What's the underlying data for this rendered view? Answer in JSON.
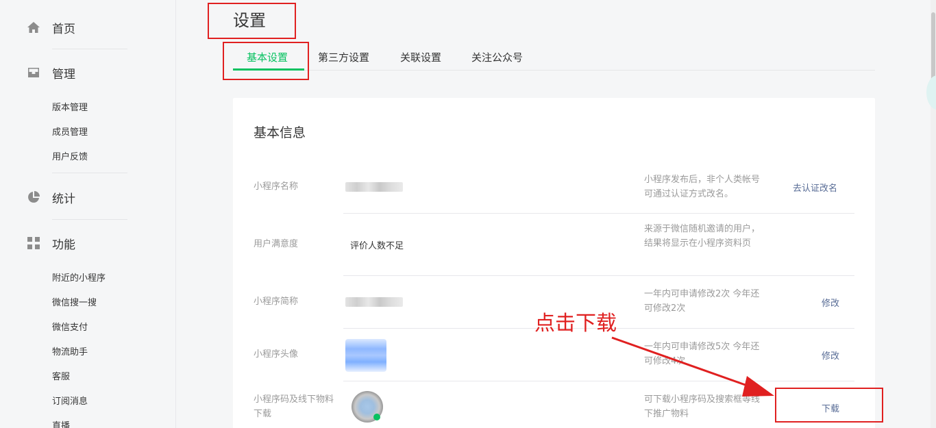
{
  "sidebar": {
    "home": {
      "label": "首页",
      "icon": "home-icon"
    },
    "manage": {
      "label": "管理",
      "icon": "inbox-icon",
      "items": [
        "版本管理",
        "成员管理",
        "用户反馈"
      ]
    },
    "stats": {
      "label": "统计",
      "icon": "pie-chart-icon"
    },
    "features": {
      "label": "功能",
      "icon": "grid-icon",
      "items": [
        "附近的小程序",
        "微信搜一搜",
        "微信支付",
        "物流助手",
        "客服",
        "订阅消息",
        "直播"
      ]
    }
  },
  "page": {
    "title": "设置",
    "tabs": [
      "基本设置",
      "第三方设置",
      "关联设置",
      "关注公众号"
    ],
    "active_tab": "基本设置"
  },
  "card": {
    "title": "基本信息",
    "rows": [
      {
        "label": "小程序名称",
        "value": "",
        "tip": "小程序发布后，非个人类帐号可通过认证方式改名。",
        "action": "去认证改名"
      },
      {
        "label": "用户满意度",
        "value": "评价人数不足",
        "tip": "来源于微信随机邀请的用户，结果将显示在小程序资料页",
        "action": ""
      },
      {
        "label": "小程序简称",
        "value": "",
        "tip": "一年内可申请修改2次 今年还可修改2次",
        "action": "修改"
      },
      {
        "label": "小程序头像",
        "value": "",
        "tip": "一年内可申请修改5次 今年还可修改4次",
        "action": "修改"
      },
      {
        "label": "小程序码及线下物料下载",
        "value": "",
        "tip": "可下载小程序码及搜索框等线下推广物料",
        "action": "下载"
      }
    ]
  },
  "annotation": {
    "text": "点击下载",
    "color": "#e02020"
  },
  "colors": {
    "accent": "#07c160",
    "link": "#576b95",
    "annotation": "#e02020"
  }
}
